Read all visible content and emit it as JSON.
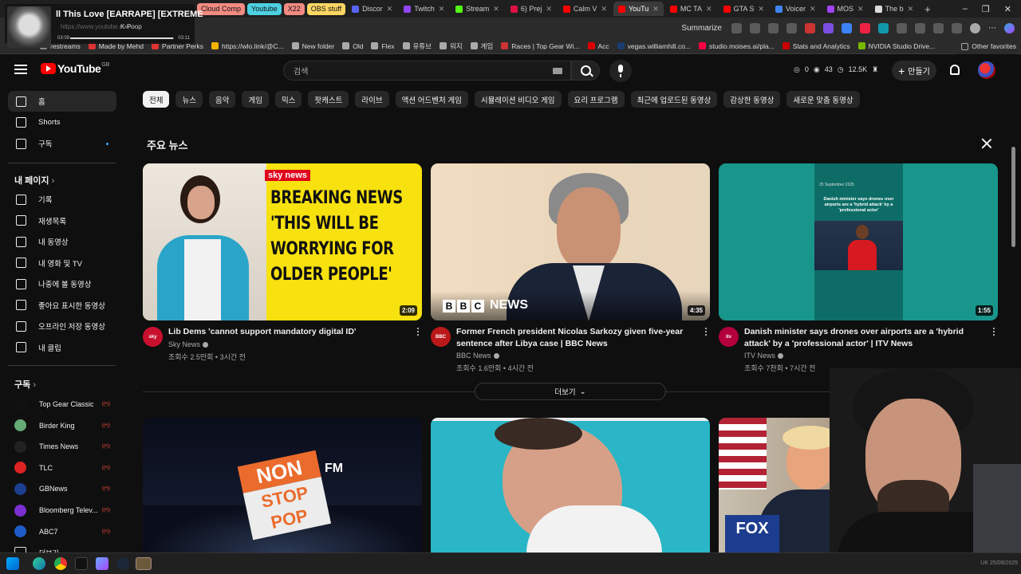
{
  "media_overlay": {
    "title": "ll This Love [EARRAPE] [EXTREME",
    "subtitle": "K-Poop",
    "ghost_url": "https://www.youtube.com",
    "elapsed": "03:09",
    "total": "03:11",
    "progress": 0.99
  },
  "browser": {
    "tab_groups": [
      {
        "label": "Cloud Comp",
        "color": "#f28b82"
      },
      {
        "label": "Youtube",
        "color": "#4dd0e1"
      },
      {
        "label": "X22",
        "color": "#f28b82"
      },
      {
        "label": "OBS stuff",
        "color": "#fdd663"
      }
    ],
    "tabs": [
      {
        "label": "Discor",
        "color": "#5865f2"
      },
      {
        "label": "Twitch",
        "color": "#9146ff"
      },
      {
        "label": "Stream",
        "color": "#53fc18"
      },
      {
        "label": "6) Prej",
        "color": "#d14"
      },
      {
        "label": "Calm V",
        "color": "#ff0000"
      },
      {
        "label": "YouTu",
        "color": "#ff0000"
      },
      {
        "label": "MC TA",
        "color": "#ff0000"
      },
      {
        "label": "GTA S",
        "color": "#ff0000"
      },
      {
        "label": "Voicer",
        "color": "#4285f4"
      },
      {
        "label": "MOS",
        "color": "#a142f4"
      },
      {
        "label": "The b",
        "color": "#ddd"
      }
    ],
    "new_tab": "+",
    "window": {
      "minimize": "–",
      "restore": "❐",
      "close": "✕"
    },
    "summarize": "Summarize",
    "bookmarks": [
      {
        "label": "restreams",
        "color": "#888"
      },
      {
        "label": "Made by Mehd",
        "color": "#d33"
      },
      {
        "label": "Partner Perks",
        "color": "#d33"
      },
      {
        "label": "https://wlo.link/@C...",
        "color": "#f4b400"
      },
      {
        "label": "New folder",
        "color": "#aaa"
      },
      {
        "label": "Old",
        "color": "#aaa"
      },
      {
        "label": "Flex",
        "color": "#aaa"
      },
      {
        "label": "유튜브",
        "color": "#aaa"
      },
      {
        "label": "워지",
        "color": "#aaa"
      },
      {
        "label": "게임",
        "color": "#aaa"
      },
      {
        "label": "Races | Top Gear Wi...",
        "color": "#c33"
      },
      {
        "label": "Acc",
        "color": "#d00"
      },
      {
        "label": "vegas.williamhill.co...",
        "color": "#1a3d6e"
      },
      {
        "label": "studio.moises.ai/pla...",
        "color": "#f04"
      },
      {
        "label": "Stats and Analytics",
        "color": "#c00"
      },
      {
        "label": "NVIDIA Studio Drive...",
        "color": "#76b900"
      }
    ],
    "other_favorites": "Other favorites"
  },
  "header": {
    "logo_text": "YouTube",
    "region": "GB",
    "search_placeholder": "검색",
    "stats": {
      "a": "0",
      "b": "43",
      "c": "12.5K"
    },
    "create_label": "만들기"
  },
  "sidebar": {
    "primary": [
      {
        "label": "홈",
        "icon": "home-icon",
        "active": true
      },
      {
        "label": "Shorts",
        "icon": "shorts-icon"
      },
      {
        "label": "구독",
        "icon": "subscriptions-icon",
        "dot": true
      }
    ],
    "you_heading": "내 페이지",
    "you": [
      {
        "label": "기록",
        "icon": "history-icon"
      },
      {
        "label": "재생목록",
        "icon": "playlists-icon"
      },
      {
        "label": "내 동영상",
        "icon": "your-videos-icon"
      },
      {
        "label": "내 영화 및 TV",
        "icon": "movies-icon"
      },
      {
        "label": "나중에 볼 동영상",
        "icon": "watch-later-icon"
      },
      {
        "label": "좋아요 표시한 동영상",
        "icon": "liked-icon"
      },
      {
        "label": "오프라인 저장 동영상",
        "icon": "downloads-icon"
      },
      {
        "label": "내 클립",
        "icon": "clips-icon"
      }
    ],
    "subs_heading": "구독",
    "subscriptions": [
      {
        "label": "Top Gear Classic",
        "color": "#111"
      },
      {
        "label": "Birder King",
        "color": "#6a7"
      },
      {
        "label": "Times News",
        "color": "#222"
      },
      {
        "label": "TLC",
        "color": "#d22"
      },
      {
        "label": "GBNews",
        "color": "#1c3f8f"
      },
      {
        "label": "Bloomberg Telev...",
        "color": "#7a2fd0"
      },
      {
        "label": "ABC7",
        "color": "#1f5cc7"
      },
      {
        "label": "더보기"
      }
    ]
  },
  "chips": [
    "전체",
    "뉴스",
    "음악",
    "게임",
    "믹스",
    "팟캐스트",
    "라이브",
    "액션 어드벤처 게임",
    "시뮬레이션 비디오 게임",
    "요리 프로그램",
    "최근에 업로드된 동영상",
    "감상한 동영상",
    "새로운 맞춤 동영상"
  ],
  "section": {
    "title": "주요 뉴스",
    "videos": [
      {
        "title": "Lib Dems 'cannot support mandatory digital ID'",
        "channel": "Sky News",
        "views": "조회수 2.5만회 • 3시간 전",
        "duration": "2:09",
        "channel_badge": "sky",
        "badge_color": "#c8102e",
        "thumb_brand": "sky news",
        "thumb_lines": [
          "BREAKING NEWS",
          "'THIS WILL BE",
          "WORRYING FOR",
          "OLDER PEOPLE'"
        ]
      },
      {
        "title": "Former French president Nicolas Sarkozy given five-year sentence after Libya case | BBC News",
        "channel": "BBC News",
        "views": "조회수 1.6만회 • 4시간 전",
        "duration": "4:35",
        "channel_badge": "BBC",
        "badge_color": "#bb1919",
        "thumb_brand_letters": [
          "B",
          "B",
          "C"
        ],
        "thumb_brand_word": "NEWS"
      },
      {
        "title": "Danish minister says drones over airports are a 'hybrid attack' by a 'professional actor' | ITV News",
        "channel": "ITV News",
        "views": "조회수 7천회 • 7시간 전",
        "duration": "1:55",
        "channel_badge": "itv",
        "badge_color": "#b3003c",
        "thumb_date": "25 September 2025",
        "thumb_caption": "Danish minister says drones over airports are a 'hybrid attack' by a 'professional actor'"
      }
    ]
  },
  "more_button": "더보기",
  "row2": {
    "nonstop_top": "NON",
    "nonstop_bottom": "STOP POP",
    "nonstop_fm": "FM",
    "fox": "FOX"
  },
  "taskbar": {
    "clock": "UK  25/09/2025",
    "apps": [
      "start",
      "edge",
      "chrome",
      "terminal",
      "proton",
      "steam",
      "iv"
    ]
  }
}
